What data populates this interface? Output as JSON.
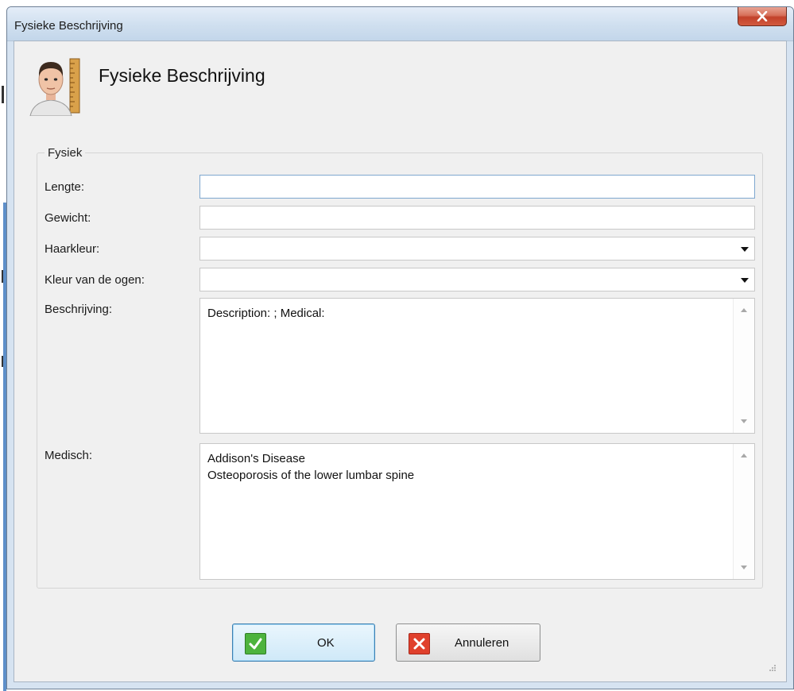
{
  "window": {
    "title": "Fysieke Beschrijving"
  },
  "header": {
    "title": "Fysieke Beschrijving",
    "icon": "person-with-height-ruler-icon"
  },
  "group": {
    "legend": "Fysiek"
  },
  "fields": {
    "length_label": "Lengte:",
    "length_value": "",
    "weight_label": "Gewicht:",
    "weight_value": "",
    "hair_label": "Haarkleur:",
    "hair_value": "",
    "eyes_label": "Kleur van de ogen:",
    "eyes_value": "",
    "description_label": "Beschrijving:",
    "description_value": "Description: ; Medical:",
    "medical_label": "Medisch:",
    "medical_value": "Addison's Disease\nOsteoporosis of the lower lumbar spine"
  },
  "buttons": {
    "ok_label": "OK",
    "cancel_label": "Annuleren"
  },
  "colors": {
    "ok_icon": "#4db33d",
    "cancel_icon": "#e0402c",
    "close_button": "#c2412a"
  }
}
